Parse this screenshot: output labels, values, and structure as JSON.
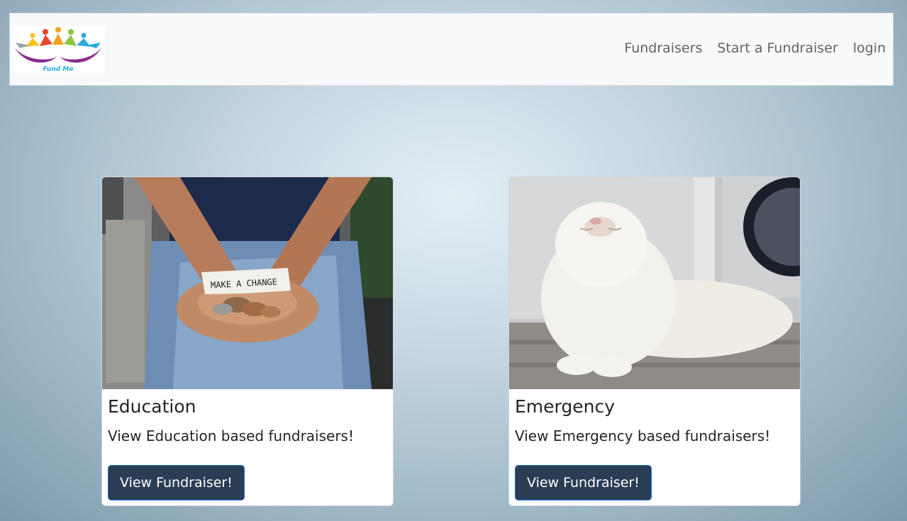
{
  "header": {
    "logo_text": "Fund Me",
    "nav": {
      "fundraisers": "Fundraisers",
      "start": "Start a Fundraiser",
      "login": "login"
    }
  },
  "cards": [
    {
      "title": "Education",
      "description": "View Education based fundraisers!",
      "button_label": "View Fundraiser!",
      "image_note": "MAKE A CHANGE"
    },
    {
      "title": "Emergency",
      "description": "View Emergency based fundraisers!",
      "button_label": "View Fundraiser!"
    }
  ],
  "colors": {
    "button_bg": "#2b3d55",
    "button_border": "#1c6fd6",
    "navbar_bg": "#f8f9fa"
  }
}
